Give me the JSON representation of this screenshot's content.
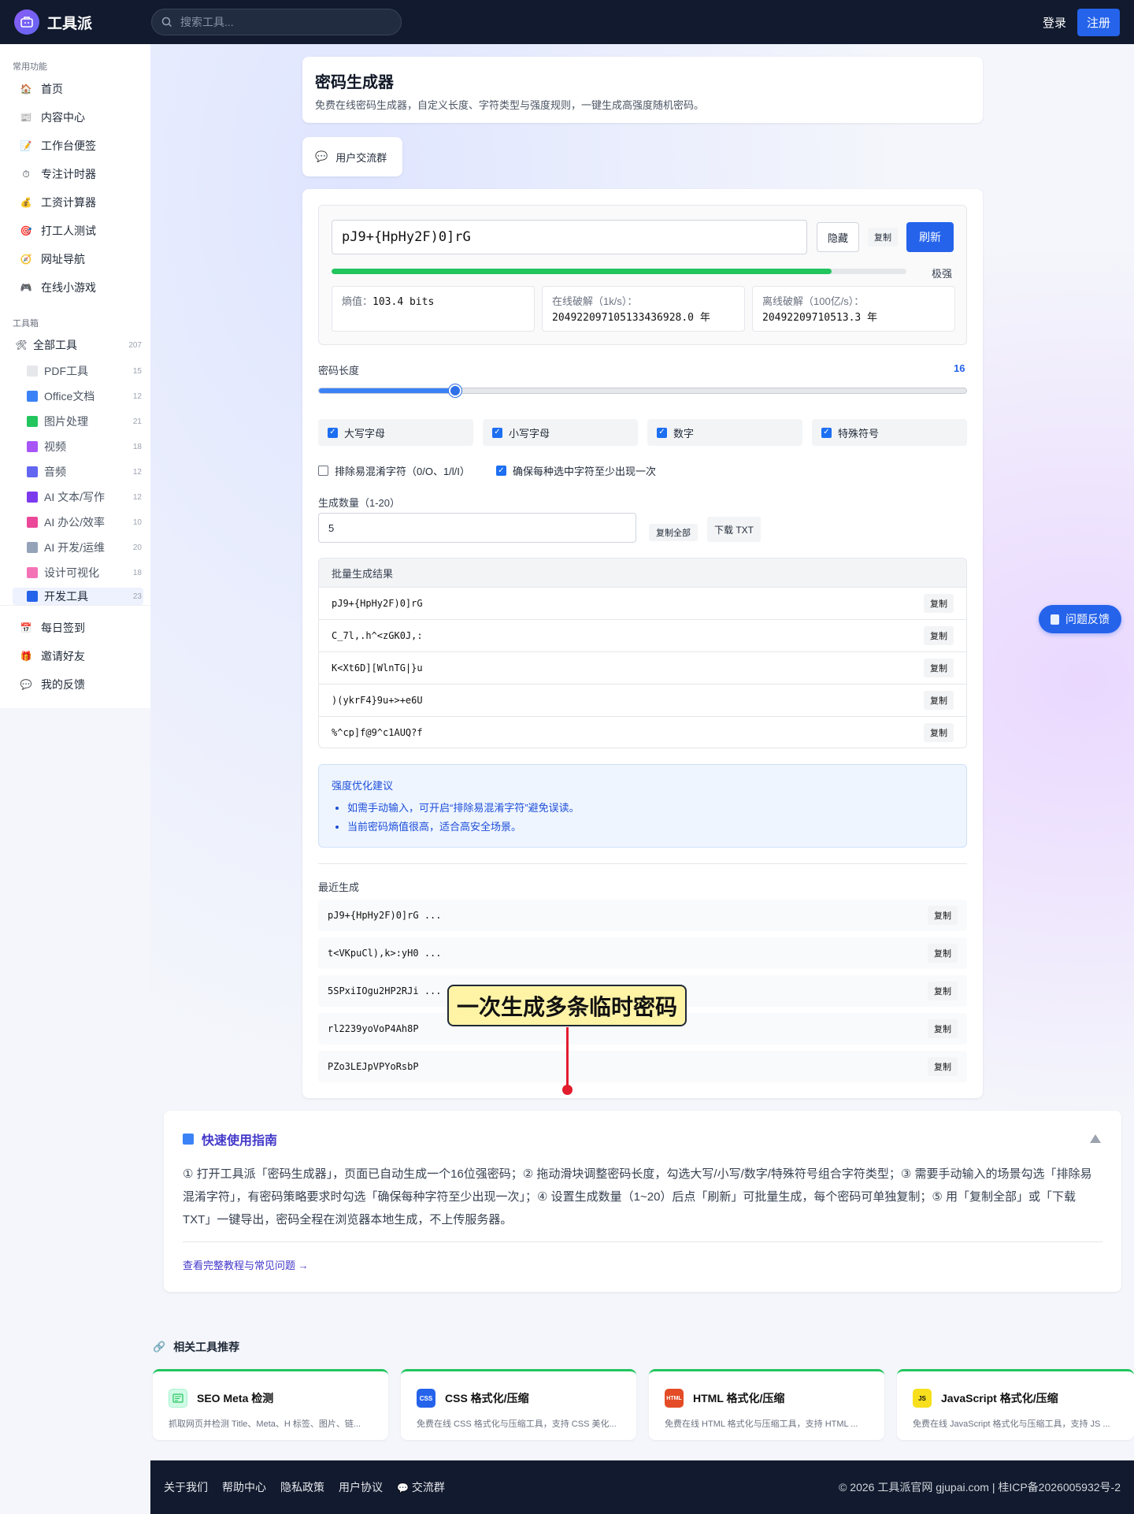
{
  "header": {
    "brand": "工具派",
    "search_placeholder": "搜索工具...",
    "login": "登录",
    "register": "注册"
  },
  "sidebar": {
    "group_common": "常用功能",
    "common_items": [
      {
        "label": "首页",
        "icon": "home-icon"
      },
      {
        "label": "内容中心",
        "icon": "news-icon"
      },
      {
        "label": "工作台便签",
        "icon": "note-icon"
      },
      {
        "label": "专注计时器",
        "icon": "timer-icon"
      },
      {
        "label": "工资计算器",
        "icon": "money-bag-icon"
      },
      {
        "label": "打工人测试",
        "icon": "target-icon"
      },
      {
        "label": "网址导航",
        "icon": "compass-icon"
      },
      {
        "label": "在线小游戏",
        "icon": "gamepad-icon"
      }
    ],
    "group_toolbox": "工具箱",
    "all_tools": {
      "label": "全部工具",
      "count": "207"
    },
    "sub_items": [
      {
        "label": "PDF工具",
        "count": "15",
        "color": "#e5e7eb"
      },
      {
        "label": "Office文档",
        "count": "12",
        "color": "#3b82f6"
      },
      {
        "label": "图片处理",
        "count": "21",
        "color": "#22c55e"
      },
      {
        "label": "视频",
        "count": "18",
        "color": "#a855f7"
      },
      {
        "label": "音频",
        "count": "12",
        "color": "#6366f1"
      },
      {
        "label": "AI 文本/写作",
        "count": "12",
        "color": "#7c3aed"
      },
      {
        "label": "AI 办公/效率",
        "count": "10",
        "color": "#ec4899"
      },
      {
        "label": "AI 开发/运维",
        "count": "20",
        "color": "#94a3b8"
      },
      {
        "label": "设计可视化",
        "count": "18",
        "color": "#f472b6"
      },
      {
        "label": "开发工具",
        "count": "23",
        "color": "#2563eb"
      }
    ],
    "bottom_items": [
      {
        "label": "每日签到",
        "icon": "calendar-icon"
      },
      {
        "label": "邀请好友",
        "icon": "gift-icon"
      },
      {
        "label": "我的反馈",
        "icon": "speech-bubble-icon"
      }
    ]
  },
  "page": {
    "title": "密码生成器",
    "subtitle": "免费在线密码生成器，自定义长度、字符类型与强度规则，一键生成高强度随机密码。",
    "group_button": "用户交流群"
  },
  "generator": {
    "password": "pJ9+{HpHy2F)0]rG",
    "hide": "隐藏",
    "copy": "复制",
    "refresh": "刷新",
    "strength_fraction": 0.87,
    "strength_label": "极强",
    "entropy_label": "熵值：",
    "entropy_value": "103.4 bits",
    "online_label": "在线破解（1k/s）：",
    "online_value": "204922097105133436928.0 年",
    "offline_label": "离线破解（100亿/s）：",
    "offline_value": "20492209710513.3 年",
    "length_label": "密码长度",
    "length_value": "16",
    "length_fraction": 0.21,
    "charsets": [
      {
        "label": "大写字母",
        "checked": true
      },
      {
        "label": "小写字母",
        "checked": true
      },
      {
        "label": "数字",
        "checked": true
      },
      {
        "label": "特殊符号",
        "checked": true
      }
    ],
    "exclude_ambiguous": "排除易混淆字符（0/O、1/l/I）",
    "ensure_each": "确保每种选中字符至少出现一次",
    "count_label": "生成数量（1-20）",
    "count_value": "5",
    "copy_all": "复制全部",
    "download_txt": "下载 TXT"
  },
  "batch": {
    "title": "批量生成结果",
    "copy": "复制",
    "rows": [
      "pJ9+{HpHy2F)0]rG",
      "C_7l,.h^<zGK0J,:",
      "K<Xt6D][WlnTG|}u",
      ")(ykrF4}9u+>+e6U",
      "%^cp]f@9^c1AUQ?f"
    ]
  },
  "tips": {
    "title": "强度优化建议",
    "items": [
      "如需手动输入，可开启“排除易混淆字符”避免误读。",
      "当前密码熵值很高，适合高安全场景。"
    ]
  },
  "recent": {
    "title": "最近生成",
    "copy": "复制",
    "rows": [
      "pJ9+{HpHy2F)0]rG ...",
      "t<VKpuCl),k>:yH0 ...",
      "5SPxiIOgu2HP2RJi ...",
      "rl2239yoVoP4Ah8P",
      "PZo3LEJpVPYoRsbP"
    ]
  },
  "callout": "一次生成多条临时密码",
  "guide": {
    "title": "快速使用指南",
    "body": "① 打开工具派「密码生成器」，页面已自动生成一个16位强密码；② 拖动滑块调整密码长度，勾选大写/小写/数字/特殊符号组合字符类型；③ 需要手动输入的场景勾选「排除易混淆字符」，有密码策略要求时勾选「确保每种字符至少出现一次」；④ 设置生成数量（1~20）后点「刷新」可批量生成，每个密码可单独复制；⑤ 用「复制全部」或「下载TXT」一键导出，密码全程在浏览器本地生成，不上传服务器。",
    "link": "查看完整教程与常见问题 →"
  },
  "related": {
    "title": "相关工具推荐",
    "items": [
      {
        "name": "SEO Meta 检测",
        "desc": "抓取网页并检测 Title、Meta、H 标签、图片、链...",
        "icon_text": "",
        "color": "#d1fae5"
      },
      {
        "name": "CSS 格式化/压缩",
        "desc": "免费在线 CSS 格式化与压缩工具，支持 CSS 美化...",
        "icon_text": "CSS",
        "color": "#2563eb"
      },
      {
        "name": "HTML 格式化/压缩",
        "desc": "免费在线 HTML 格式化与压缩工具，支持 HTML ...",
        "icon_text": "HTML",
        "color": "#e34c26"
      },
      {
        "name": "JavaScript 格式化/压缩",
        "desc": "免费在线 JavaScript 格式化与压缩工具，支持 JS ...",
        "icon_text": "JS",
        "color": "#f7df1e"
      }
    ]
  },
  "footer": {
    "links": [
      "关于我们",
      "帮助中心",
      "隐私政策",
      "用户协议",
      "交流群"
    ],
    "copyright": "© 2026 工具派官网 gjupai.com | 桂ICP备2026005932号-2"
  },
  "feedback": "问题反馈"
}
